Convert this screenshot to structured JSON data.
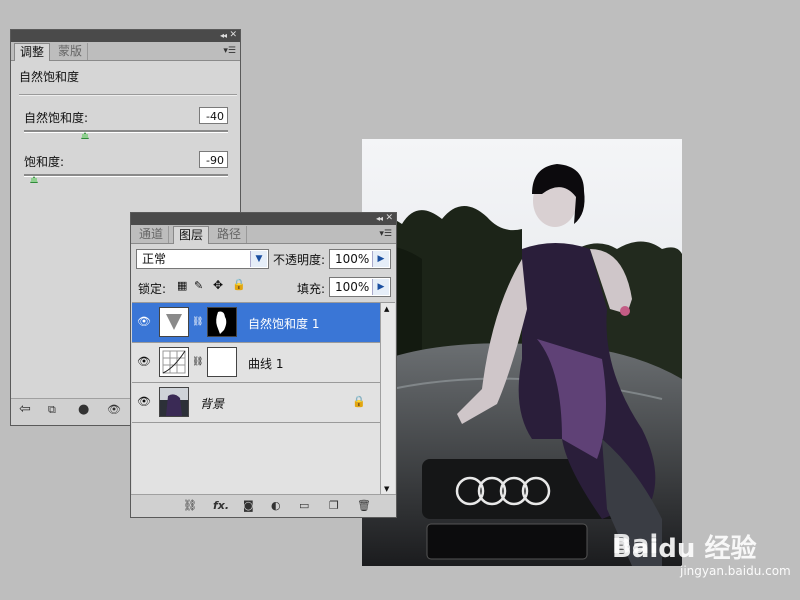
{
  "adjustments_panel": {
    "tabs": [
      "调整",
      "蒙版"
    ],
    "active_tab": 0,
    "heading": "自然饱和度",
    "sliders": [
      {
        "label": "自然饱和度:",
        "value": "-40",
        "level": 0.3
      },
      {
        "label": "饱和度:",
        "value": "-90",
        "level": 0.05
      }
    ],
    "bottom_icons": [
      "back-arrow-icon",
      "clip-to-layer-icon",
      "visibility-toggle-icon",
      "eye-icon"
    ]
  },
  "layers_panel": {
    "tabs": [
      "通道",
      "图层",
      "路径"
    ],
    "active_tab": 1,
    "blend_mode": "正常",
    "opacity_label": "不透明度:",
    "opacity_value": "100%",
    "lock_label": "锁定:",
    "fill_label": "填充:",
    "fill_value": "100%",
    "layers": [
      {
        "name": "自然饱和度 1",
        "selected": true,
        "type": "vibrance-adjustment"
      },
      {
        "name": "曲线 1",
        "selected": false,
        "type": "curves-adjustment"
      },
      {
        "name": "背景",
        "selected": false,
        "type": "background",
        "locked": true
      }
    ],
    "bottom_icons": [
      "link-icon",
      "fx-icon",
      "mask-icon",
      "adjustment-icon",
      "folder-icon",
      "new-layer-icon",
      "trash-icon"
    ],
    "fx_label": "fx."
  },
  "watermark": {
    "brand": "Baidu 经验",
    "url": "jingyan.baidu.com"
  },
  "colors": {
    "selection": "#3a76d6",
    "canvas_bg": "#bebebe",
    "panel_bg": "#d6d6d6"
  }
}
